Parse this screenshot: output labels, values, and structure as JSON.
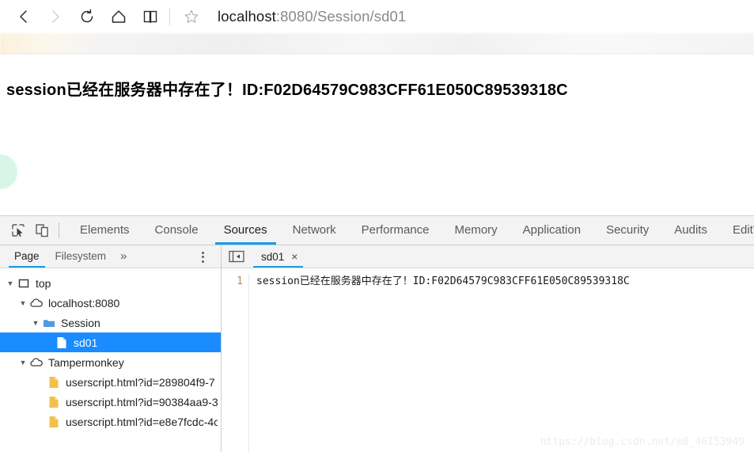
{
  "browser": {
    "nav": [
      {
        "name": "back-button",
        "icon": "chevron-left-icon",
        "state": "enabled"
      },
      {
        "name": "forward-button",
        "icon": "chevron-right-icon",
        "state": "disabled"
      },
      {
        "name": "refresh-button",
        "icon": "refresh-icon",
        "state": "enabled"
      },
      {
        "name": "home-button",
        "icon": "home-icon",
        "state": "enabled"
      },
      {
        "name": "reading-view-button",
        "icon": "book-icon",
        "state": "enabled"
      }
    ],
    "favorite_icon": "star-icon",
    "url": {
      "host": "localhost",
      "rest": ":8080/Session/sd01",
      "full": "localhost:8080/Session/sd01"
    }
  },
  "page": {
    "body_text": "session已经在服务器中存在了！ID:F02D64579C983CFF61E050C89539318C",
    "session_id": "F02D64579C983CFF61E050C89539318C"
  },
  "devtools": {
    "inspect_icon": "inspect-element-icon",
    "device_icon": "device-toolbar-icon",
    "tabs": [
      {
        "label": "Elements",
        "active": false
      },
      {
        "label": "Console",
        "active": false
      },
      {
        "label": "Sources",
        "active": true
      },
      {
        "label": "Network",
        "active": false
      },
      {
        "label": "Performance",
        "active": false
      },
      {
        "label": "Memory",
        "active": false
      },
      {
        "label": "Application",
        "active": false
      },
      {
        "label": "Security",
        "active": false
      },
      {
        "label": "Audits",
        "active": false
      },
      {
        "label": "EditThisC",
        "active": false
      }
    ],
    "navigator": {
      "tabs": [
        {
          "label": "Page",
          "active": true
        },
        {
          "label": "Filesystem",
          "active": false
        }
      ],
      "overflow_label": "»",
      "more_menu_icon": "kebab-menu-icon",
      "tree": [
        {
          "label": "top",
          "icon": "frame-icon",
          "depth": 0,
          "expanded": true,
          "selected": false
        },
        {
          "label": "localhost:8080",
          "icon": "cloud-icon",
          "depth": 1,
          "expanded": true,
          "selected": false
        },
        {
          "label": "Session",
          "icon": "folder-icon",
          "depth": 2,
          "expanded": true,
          "selected": false
        },
        {
          "label": "sd01",
          "icon": "file-icon",
          "depth": 3,
          "expanded": null,
          "selected": true
        },
        {
          "label": "Tampermonkey",
          "icon": "cloud-icon",
          "depth": 1,
          "expanded": true,
          "selected": false
        },
        {
          "label": "userscript.html?id=289804f9-7",
          "icon": "script-file-icon",
          "depth": 2,
          "expanded": null,
          "selected": false
        },
        {
          "label": "userscript.html?id=90384aa9-3",
          "icon": "script-file-icon",
          "depth": 2,
          "expanded": null,
          "selected": false
        },
        {
          "label": "userscript.html?id=e8e7fcdc-4c",
          "icon": "script-file-icon",
          "depth": 2,
          "expanded": null,
          "selected": false
        }
      ]
    },
    "editor": {
      "panel_toggle_icon": "show-navigator-icon",
      "file_tab": {
        "label": "sd01",
        "close_icon": "×"
      },
      "lines": [
        {
          "number": "1",
          "text": "session已经在服务器中存在了！ID:F02D64579C983CFF61E050C89539318C"
        }
      ]
    }
  },
  "watermark": {
    "text": "https://blog.csdn.net/m0_46153949"
  },
  "colors": {
    "accent_blue": "#1a9ae8",
    "selection_blue": "#1a8cff",
    "folder_blue": "#4f9ae0",
    "script_yellow": "#f2c14b",
    "gutter_text": "#b58a5a"
  }
}
